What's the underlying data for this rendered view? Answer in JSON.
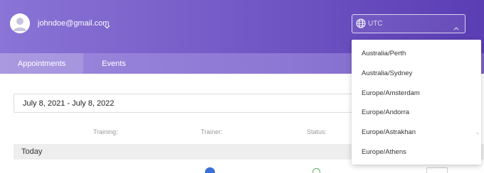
{
  "header": {
    "user_email": "johndoe@gmail.com",
    "timezone": {
      "value": "UTC",
      "options": [
        "Australia/Perth",
        "Australia/Sydney",
        "Europe/Amsterdam",
        "Europe/Andorra",
        "Europe/Astrakhan",
        "Europe/Athens"
      ]
    }
  },
  "tabs": {
    "appointments": "Appointments",
    "events": "Events"
  },
  "filter": {
    "date_range": "July 8, 2021 - July 8, 2022"
  },
  "table": {
    "columns": {
      "training": "Training:",
      "trainer": "Trainer:",
      "status": "Status:"
    },
    "group_label": "Today"
  },
  "colors": {
    "header_gradient_start": "#8a74d6",
    "header_gradient_end": "#5b3db4",
    "tabbar": "#8c77d4",
    "trainer_avatar": "#3b6fd8",
    "status_ok": "#5bb06a"
  }
}
